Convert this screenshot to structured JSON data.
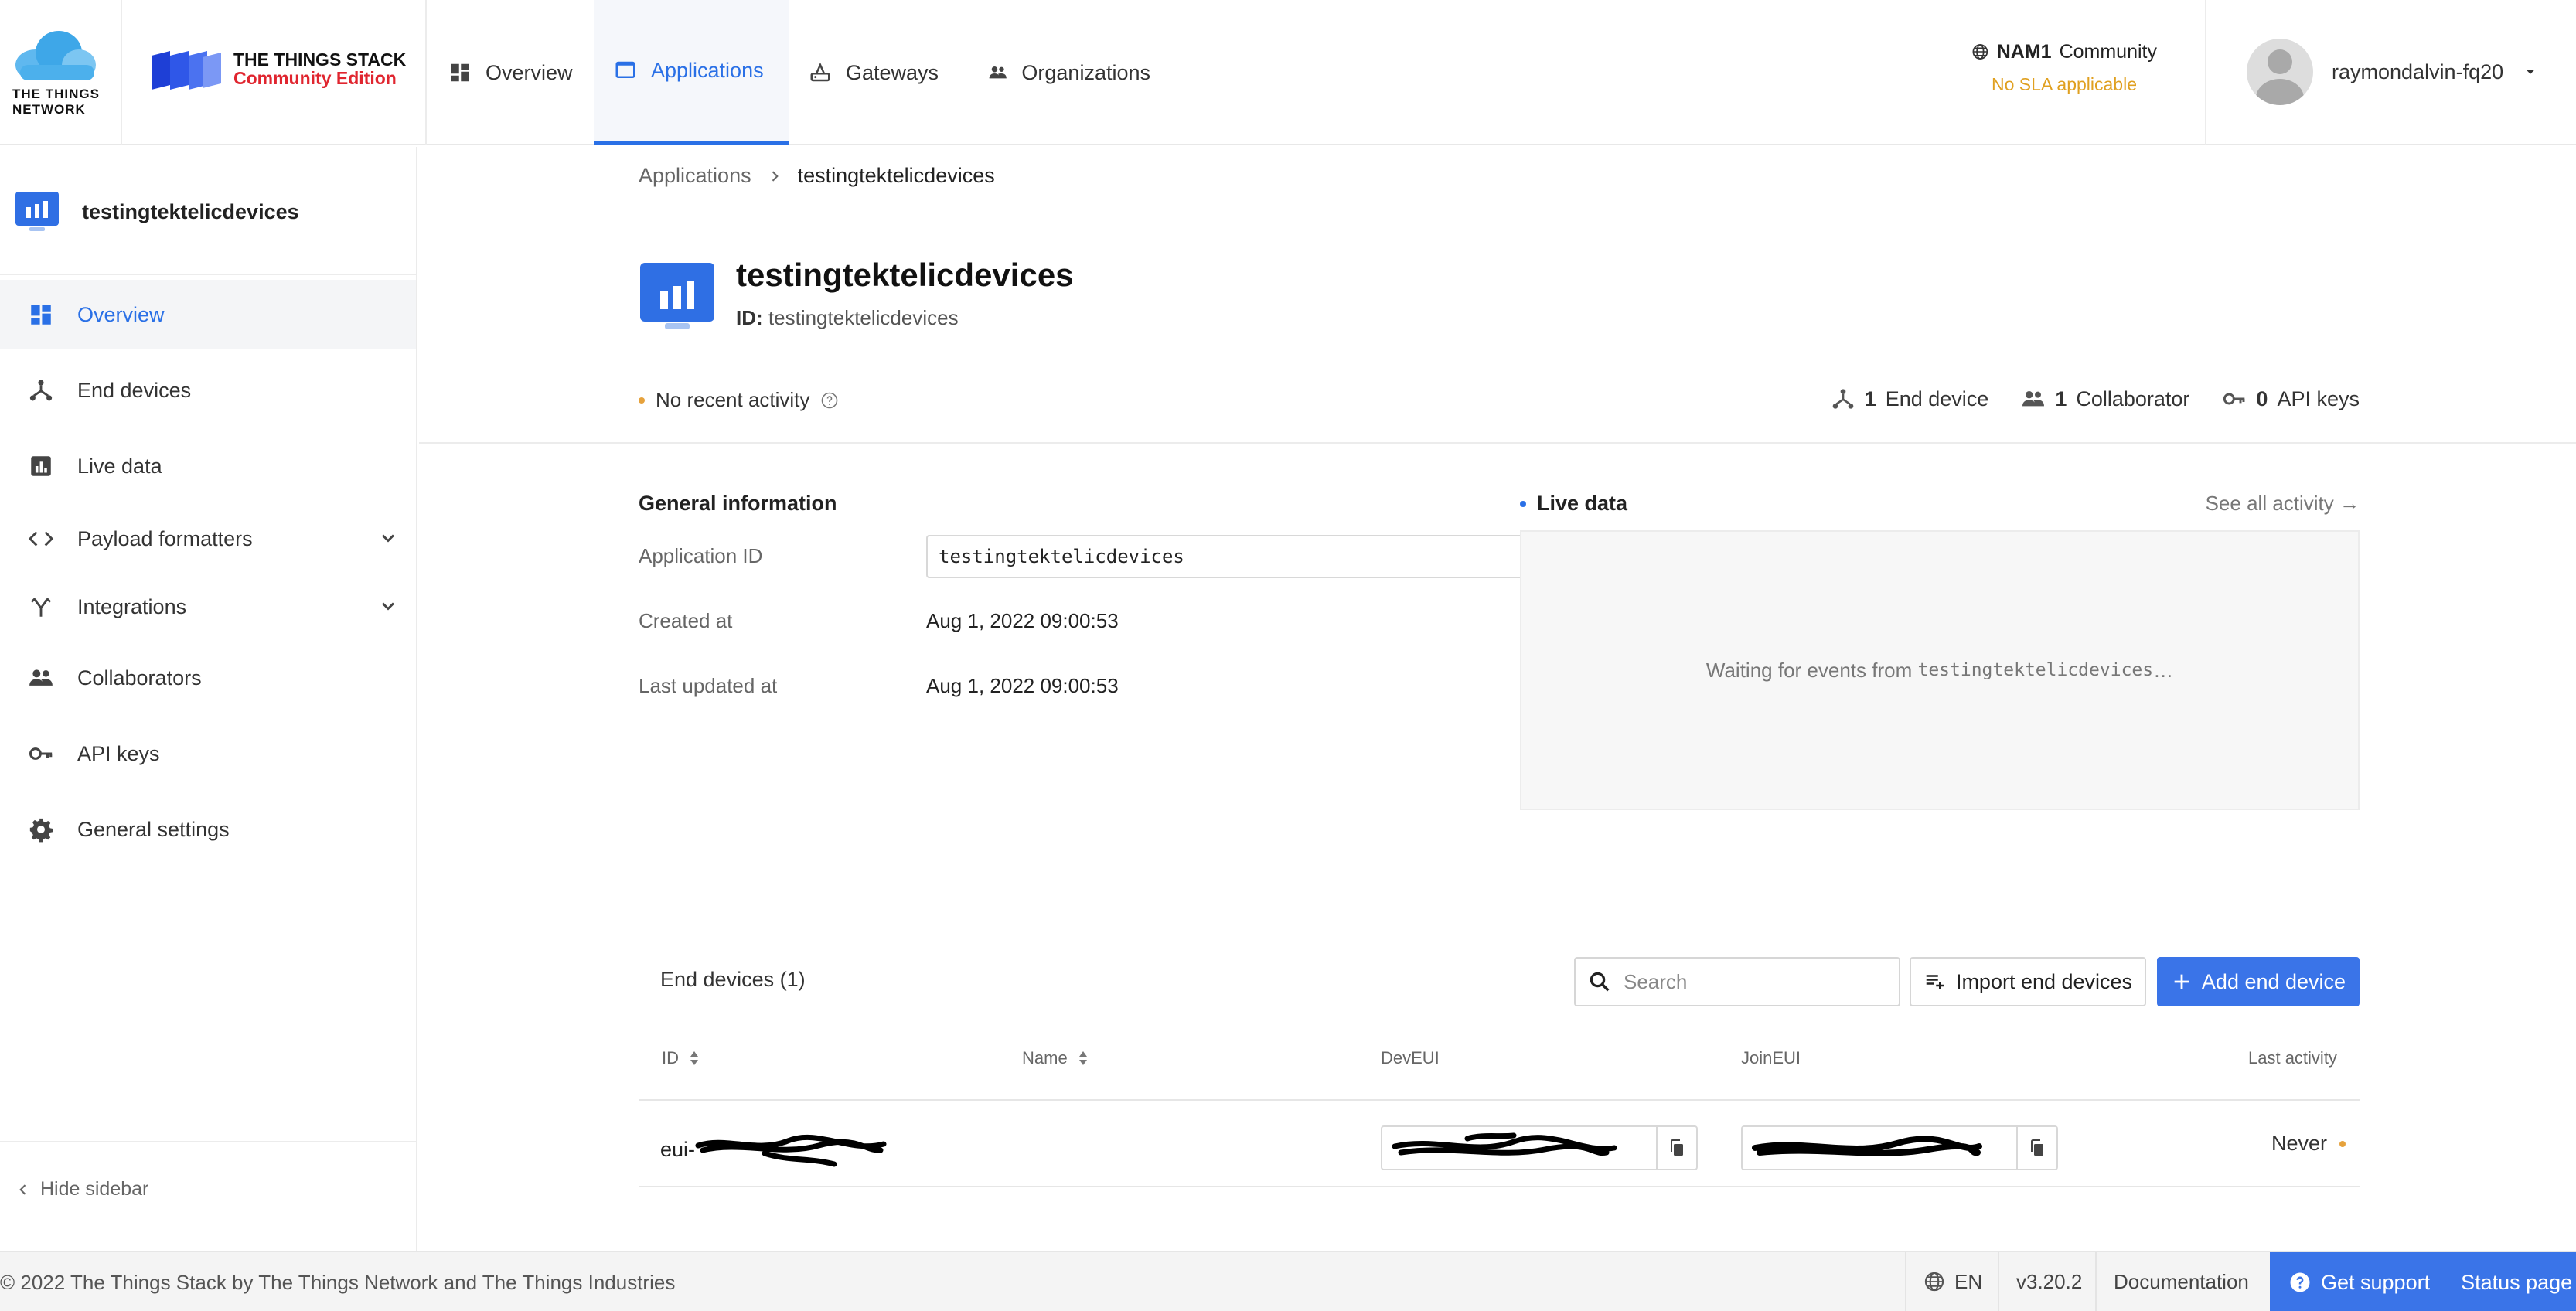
{
  "brand": {
    "ttn_line1": "THE THINGS",
    "ttn_line2": "NETWORK",
    "stack_line1": "THE THINGS STACK",
    "stack_line2": "Community Edition",
    "ttn_color": "#3ea7e8",
    "edition_color": "#e0252f"
  },
  "nav": {
    "items": [
      {
        "label": "Overview",
        "icon": "dashboard-icon",
        "active": false
      },
      {
        "label": "Applications",
        "icon": "monitor-icon",
        "active": true
      },
      {
        "label": "Gateways",
        "icon": "gateway-icon",
        "active": false
      },
      {
        "label": "Organizations",
        "icon": "people-icon",
        "active": false
      }
    ],
    "accent": "#2a70e6"
  },
  "region": {
    "code": "NAM1",
    "label": "Community",
    "note": "No SLA applicable"
  },
  "user": {
    "name": "raymondalvin-fq20"
  },
  "sidebar": {
    "app_name": "testingtektelicdevices",
    "items": [
      {
        "label": "Overview",
        "icon": "dashboard-icon",
        "active": true
      },
      {
        "label": "End devices",
        "icon": "device-icon"
      },
      {
        "label": "Live data",
        "icon": "chart-icon"
      },
      {
        "label": "Payload formatters",
        "icon": "code-icon",
        "expandable": true
      },
      {
        "label": "Integrations",
        "icon": "merge-icon",
        "expandable": true
      },
      {
        "label": "Collaborators",
        "icon": "people-icon"
      },
      {
        "label": "API keys",
        "icon": "key-icon"
      },
      {
        "label": "General settings",
        "icon": "gear-icon"
      }
    ],
    "hide_label": "Hide sidebar"
  },
  "breadcrumb": {
    "root": "Applications",
    "current": "testingtektelicdevices"
  },
  "app": {
    "title": "testingtektelicdevices",
    "id_label": "ID:",
    "id_value": "testingtektelicdevices",
    "activity": "No recent activity",
    "stats": {
      "end_devices_count": "1",
      "end_devices_label": "End device",
      "collaborators_count": "1",
      "collaborators_label": "Collaborator",
      "api_keys_count": "0",
      "api_keys_label": "API keys"
    }
  },
  "general_info": {
    "title": "General information",
    "app_id_label": "Application ID",
    "app_id_value": "testingtektelicdevices",
    "created_label": "Created at",
    "created_value": "Aug 1, 2022 09:00:53",
    "updated_label": "Last updated at",
    "updated_value": "Aug 1, 2022 09:00:53"
  },
  "live_data": {
    "title": "Live data",
    "see_all": "See all activity →",
    "waiting_prefix": "Waiting for events from ",
    "waiting_app": "testingtektelicdevices",
    "waiting_suffix": "…"
  },
  "devices_table": {
    "title": "End devices (1)",
    "search_placeholder": "Search",
    "import_label": "Import end devices",
    "add_label": "Add end device",
    "columns": {
      "id": "ID",
      "name": "Name",
      "deveui": "DevEUI",
      "joineui": "JoinEUI",
      "last_activity": "Last activity"
    },
    "rows": [
      {
        "id_prefix": "eui-",
        "name": "",
        "last_activity": "Never"
      }
    ]
  },
  "footer": {
    "copyright": "© 2022 The Things Stack by The Things Network and The Things Industries",
    "language": "EN",
    "version": "v3.20.2",
    "documentation": "Documentation",
    "support": "Get support",
    "status": "Status page"
  }
}
